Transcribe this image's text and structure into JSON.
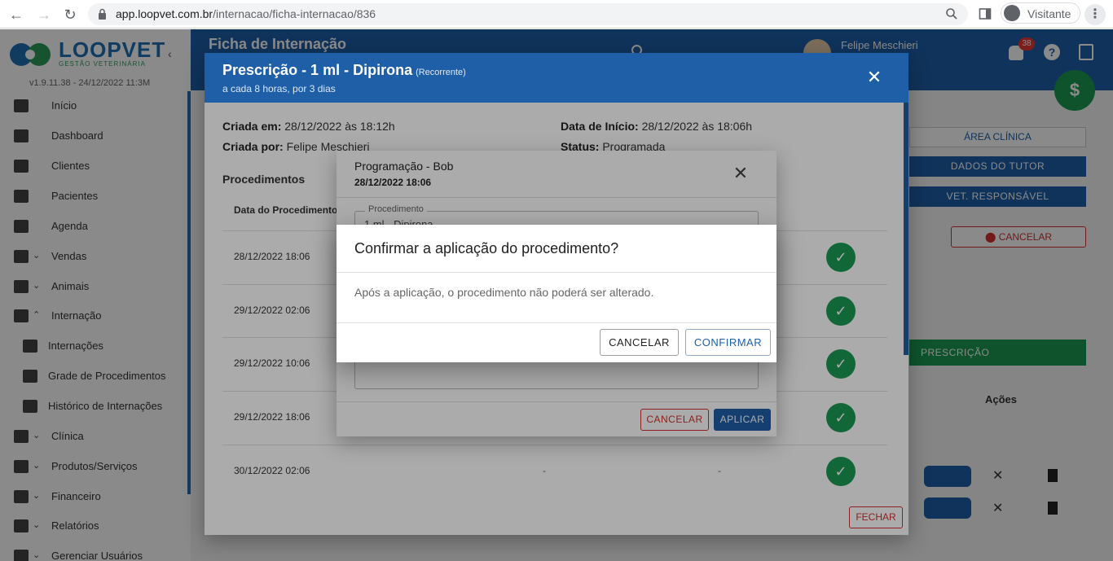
{
  "browser": {
    "url_domain": "app.loopvet.com.br",
    "url_path": "/internacao/ficha-internacao/836",
    "profile_label": "Visitante"
  },
  "sidebar": {
    "logo_text": "LOOPVET",
    "logo_sub": "GESTÃO VETERINÁRIA",
    "version": "v1.9.11.38 - 24/12/2022 11:3M",
    "items": [
      {
        "label": "Início"
      },
      {
        "label": "Dashboard"
      },
      {
        "label": "Clientes"
      },
      {
        "label": "Pacientes"
      },
      {
        "label": "Agenda"
      },
      {
        "label": "Vendas"
      },
      {
        "label": "Animais"
      },
      {
        "label": "Internação"
      },
      {
        "label": "Internações"
      },
      {
        "label": "Grade de Procedimentos"
      },
      {
        "label": "Histórico de Internações"
      },
      {
        "label": "Clínica"
      },
      {
        "label": "Produtos/Serviços"
      },
      {
        "label": "Financeiro"
      },
      {
        "label": "Relatórios"
      },
      {
        "label": "Gerenciar Usuários"
      }
    ]
  },
  "topbar": {
    "title": "Ficha de Internação",
    "user_name": "Felipe Meschieri",
    "notif_count": "38"
  },
  "right_panel": {
    "area_label": "ÁREA CLÍNICA",
    "tutor_button": "DADOS DO TUTOR",
    "vet_button": "VET. RESPONSÁVEL",
    "cancel_button": "CANCELAR",
    "presc_button": "PRESCRIÇÃO",
    "actions_header": "Ações"
  },
  "prescription": {
    "title": "Prescrição - 1 ml - Dipirona",
    "tag": "(Recorrente)",
    "subtitle": "a cada 8 horas, por 3 dias",
    "created_at_label": "Criada em:",
    "created_at_value": "28/12/2022 às 18:12h",
    "created_by_label": "Criada por:",
    "created_by_value": "Felipe Meschieri",
    "start_label": "Data de Início:",
    "start_value": "28/12/2022 às 18:06h",
    "status_label": "Status:",
    "status_value": "Programada",
    "procedures_title": "Procedimentos",
    "col_date": "Data do Procedimento",
    "rows": [
      {
        "date": "28/12/2022 18:06",
        "c1": "",
        "c2": ""
      },
      {
        "date": "29/12/2022 02:06",
        "c1": "",
        "c2": ""
      },
      {
        "date": "29/12/2022 10:06",
        "c1": "",
        "c2": ""
      },
      {
        "date": "29/12/2022 18:06",
        "c1": "",
        "c2": ""
      },
      {
        "date": "30/12/2022 02:06",
        "c1": "-",
        "c2": "-"
      }
    ],
    "close_button": "FECHAR"
  },
  "schedule": {
    "title": "Programação - Bob",
    "date": "28/12/2022 18:06",
    "field_label": "Procedimento",
    "field_value": "1 ml - Dipirona",
    "cancel_button": "CANCELAR",
    "apply_button": "APLICAR"
  },
  "confirm": {
    "title": "Confirmar a aplicação do procedimento?",
    "message": "Após a aplicação, o procedimento não poderá ser alterado.",
    "cancel_button": "CANCELAR",
    "confirm_button": "CONFIRMAR"
  },
  "colors": {
    "primary": "#1e5fa8",
    "success": "#1a9a52",
    "danger": "#d32f2f"
  },
  "icons": [
    "back-icon",
    "forward-icon",
    "reload-icon",
    "lock-icon",
    "zoom-icon",
    "sidepanel-icon",
    "profile-icon",
    "kebab-icon",
    "close-icon",
    "check-icon",
    "bell-icon",
    "help-icon",
    "logout-icon"
  ]
}
